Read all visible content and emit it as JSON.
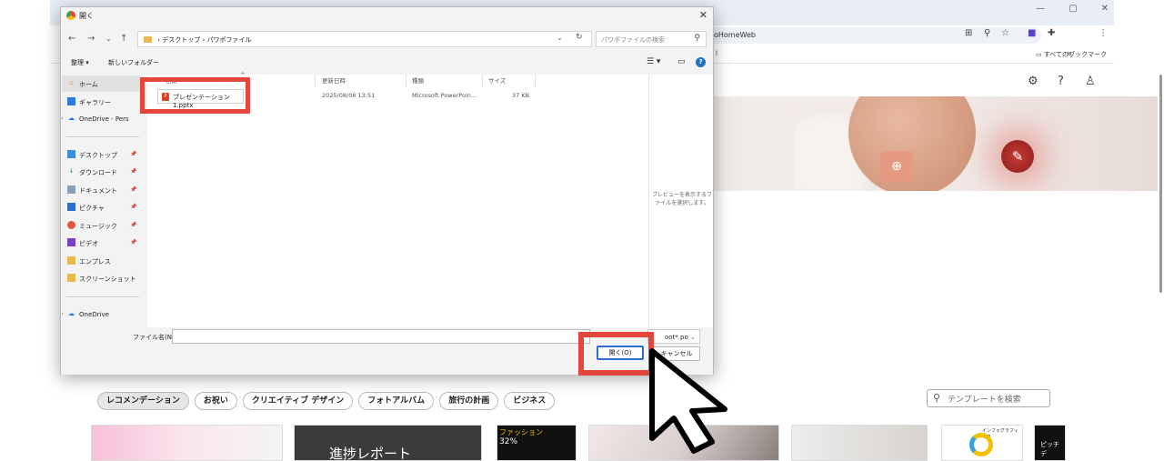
{
  "browser": {
    "window_controls": [
      "—",
      "▢",
      "✕"
    ],
    "address_text": "oHomeWeb",
    "bookmarks_label": "すべてのブックマーク",
    "bookmark_fragment": "l",
    "icons": [
      "translate-icon",
      "zoom-icon",
      "star-icon",
      "extension-icon",
      "puzzle-icon",
      "menu-icon",
      "settings-icon",
      "help-icon",
      "account-icon"
    ]
  },
  "dialog": {
    "title": "開く",
    "breadcrumb": [
      "デスクトップ",
      "パワポファイル"
    ],
    "search_placeholder": "パワポファイルの検索",
    "commands": {
      "organize": "整理 ▾",
      "new_folder": "新しいフォルダー"
    },
    "nav_items": [
      {
        "label": "ホーム",
        "icon": "home-icon",
        "pinned": false,
        "selected": true
      },
      {
        "label": "ギャラリー",
        "icon": "gallery-icon",
        "pinned": false,
        "selected": false
      },
      {
        "label": "OneDrive - Pers",
        "icon": "onedrive-icon",
        "pinned": false,
        "selected": false
      },
      {
        "label": "デスクトップ",
        "icon": "desktop-icon",
        "pinned": true,
        "selected": false
      },
      {
        "label": "ダウンロード",
        "icon": "download-icon",
        "pinned": true,
        "selected": false
      },
      {
        "label": "ドキュメント",
        "icon": "document-icon",
        "pinned": true,
        "selected": false
      },
      {
        "label": "ピクチャ",
        "icon": "pictures-icon",
        "pinned": true,
        "selected": false
      },
      {
        "label": "ミュージック",
        "icon": "music-icon",
        "pinned": true,
        "selected": false
      },
      {
        "label": "ビデオ",
        "icon": "video-icon",
        "pinned": true,
        "selected": false
      },
      {
        "label": "エンプレス",
        "icon": "folder-icon",
        "pinned": false,
        "selected": false
      },
      {
        "label": "スクリーンショット",
        "icon": "folder-icon",
        "pinned": false,
        "selected": false
      },
      {
        "label": "OneDrive",
        "icon": "onedrive-icon",
        "pinned": false,
        "selected": false
      }
    ],
    "columns": [
      "名前",
      "更新日時",
      "種類",
      "サイズ"
    ],
    "files": [
      {
        "name": "プレゼンテーション1.pptx",
        "modified": "2025/08/06 13:51",
        "type": "Microsoft PowerPoin...",
        "size": "37 KB"
      }
    ],
    "preview_text": "プレビューを表示するファイルを選択します。",
    "filename_label": "ファイル名(N):",
    "filename_value": "",
    "filter_value": "oot*.po",
    "open_label": "開く(O)",
    "cancel_label": "キャンセル"
  },
  "gallery": {
    "chips": [
      "レコメンデーション",
      "お祝い",
      "クリエイティブ デザイン",
      "フォトアルバム",
      "旅行の計画",
      "ビジネス"
    ],
    "search_placeholder": "テンプレートを検索",
    "thumb_titles": [
      "進捗レポート",
      "ファッション",
      "ピッチ デ"
    ],
    "thumb_misc": [
      "32%",
      "インフォグラフィック"
    ]
  },
  "colors": {
    "highlight": "#e3473b",
    "accent": "#1e73c8"
  }
}
